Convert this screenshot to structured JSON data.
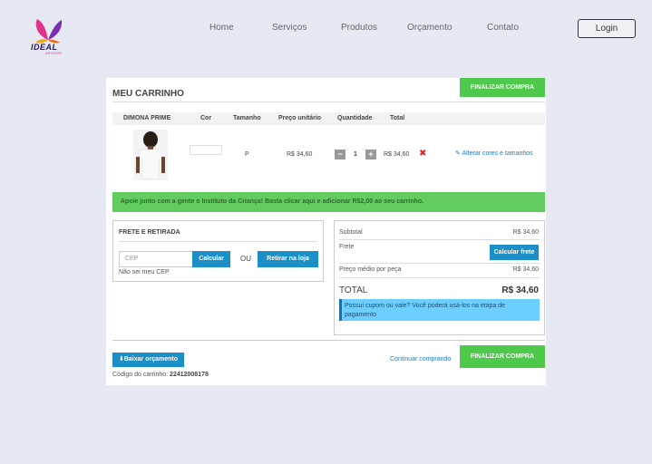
{
  "header": {
    "logo_text": "IDEAL",
    "logo_sub": "ARTIGOS",
    "nav": [
      "Home",
      "Serviços",
      "Produtos",
      "Orçamento",
      "Contato"
    ],
    "login_label": "Login"
  },
  "cart": {
    "title": "MEU CARRINHO",
    "finalizar_label": "FINALIZAR COMPRA",
    "columns": [
      "DIMONA PRIME",
      "Cor",
      "Tamanho",
      "Preço unitário",
      "Quantidade",
      "Total"
    ],
    "item": {
      "size": "P",
      "unit_price": "R$ 34,60",
      "quantity": "1",
      "total": "R$ 34,60",
      "alter_link": "Alterar cores e tamanhos"
    },
    "promo": "Apoie junto com a gente o Instituto da Criança! Basta clicar aqui e adicionar R$2,00 ao seu carrinho."
  },
  "frete": {
    "title": "FRETE E RETIRADA",
    "cep_placeholder": "CEP",
    "calcular_label": "Calcular",
    "ou": "OU",
    "retirar_label": "Retirar na loja",
    "nao_sei": "Não sei meu CEP"
  },
  "summary": {
    "subtotal_label": "Subtotal",
    "subtotal_value": "R$ 34,60",
    "frete_label": "Frete",
    "calcular_frete_label": "Calcular frete",
    "preco_medio_label": "Preço médio por peça",
    "preco_medio_value": "R$ 34,60",
    "total_label": "TOTAL",
    "total_value": "R$ 34,60",
    "cupom_text": "Possui cupom ou vale? Você poderá usá-los na etapa de pagamento"
  },
  "footer": {
    "baixar_label": "Baixar orçamento",
    "continuar_label": "Continuar comprando",
    "codigo_label": "Código do carrinho:",
    "codigo_value": "22412008178"
  },
  "colors": {
    "green": "#4ec94c",
    "blue": "#1d8fc8",
    "background": "#e6e9f2"
  }
}
